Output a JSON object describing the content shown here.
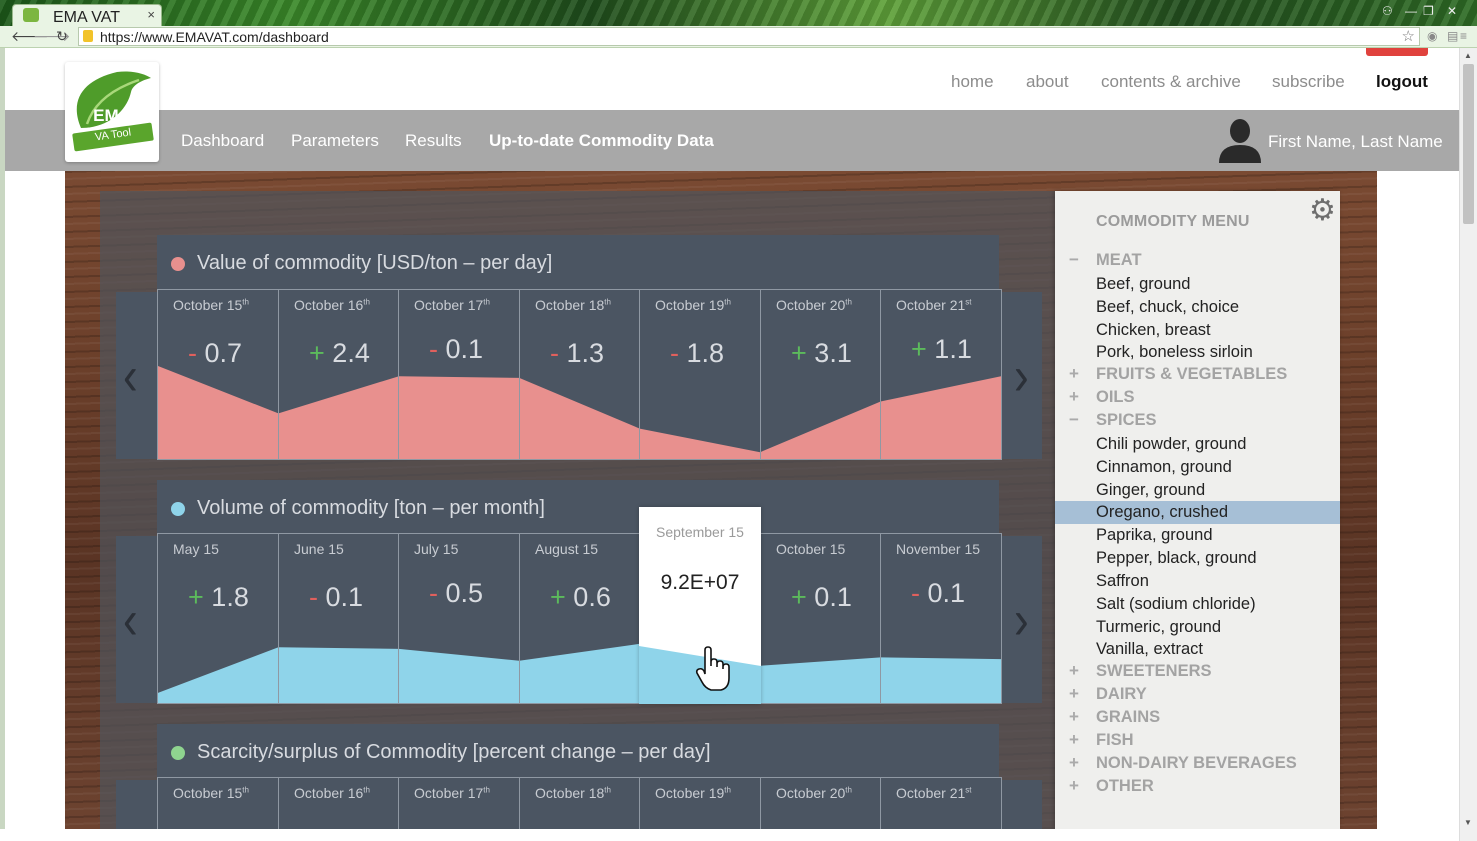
{
  "browser": {
    "tab_title": "EMA VAT",
    "tab_close": "×",
    "url": "https://www.EMAVAT.com/dashboard"
  },
  "header": {
    "nav": [
      "home",
      "about",
      "contents & archive",
      "subscribe",
      "logout"
    ],
    "menu": [
      "Dashboard",
      "Parameters",
      "Results",
      "Up-to-date Commodity Data"
    ],
    "active_menu": "Up-to-date Commodity Data",
    "user_name": "First Name, Last Name"
  },
  "logo": {
    "title": "EMA",
    "subtitle": "VA Tool"
  },
  "colors": {
    "value_series": "#e8908e",
    "volume_series": "#8fd4ea",
    "scarcity_dot": "#8fd48f",
    "selected_row": "#a6bfd6",
    "negative": "#e0605d",
    "positive": "#5cbb5c"
  },
  "panels": [
    {
      "title": "Value of commodity [USD/ton – per day]",
      "dot_color": "#e8908e",
      "labels": [
        {
          "text": "October 15",
          "sup": "th"
        },
        {
          "text": "October 16",
          "sup": "th"
        },
        {
          "text": "October 17",
          "sup": "th"
        },
        {
          "text": "October 18",
          "sup": "th"
        },
        {
          "text": "October 19",
          "sup": "th"
        },
        {
          "text": "October 20",
          "sup": "th"
        },
        {
          "text": "October 21",
          "sup": "st"
        }
      ],
      "values": [
        {
          "sign": "-",
          "num": "0.7"
        },
        {
          "sign": "+",
          "num": "2.4"
        },
        {
          "sign": "-",
          "num": "0.1"
        },
        {
          "sign": "-",
          "num": "1.3"
        },
        {
          "sign": "-",
          "num": "1.8"
        },
        {
          "sign": "+",
          "num": "3.1"
        },
        {
          "sign": "+",
          "num": "1.1"
        }
      ]
    },
    {
      "title": "Volume of commodity [ton – per month]",
      "dot_color": "#8fd4ea",
      "labels": [
        {
          "text": "May 15",
          "sup": ""
        },
        {
          "text": "June 15",
          "sup": ""
        },
        {
          "text": "July 15",
          "sup": ""
        },
        {
          "text": "August 15",
          "sup": ""
        },
        {
          "text": "September 15",
          "sup": ""
        },
        {
          "text": "October 15",
          "sup": ""
        },
        {
          "text": "November 15",
          "sup": ""
        }
      ],
      "values": [
        {
          "sign": "+",
          "num": "1.8"
        },
        {
          "sign": "-",
          "num": "0.1"
        },
        {
          "sign": "-",
          "num": "0.5"
        },
        {
          "sign": "+",
          "num": "0.6"
        },
        {
          "sign": "",
          "num": ""
        },
        {
          "sign": "+",
          "num": "0.1"
        },
        {
          "sign": "-",
          "num": "0.1"
        }
      ],
      "tooltip": {
        "date": "September 15",
        "value": "9.2E+07"
      }
    },
    {
      "title": "Scarcity/surplus of Commodity [percent change – per day]",
      "dot_color": "#8fd48f",
      "labels": [
        {
          "text": "October 15",
          "sup": "th"
        },
        {
          "text": "October 16",
          "sup": "th"
        },
        {
          "text": "October 17",
          "sup": "th"
        },
        {
          "text": "October 18",
          "sup": "th"
        },
        {
          "text": "October 19",
          "sup": "th"
        },
        {
          "text": "October 20",
          "sup": "th"
        },
        {
          "text": "October 21",
          "sup": "st"
        }
      ]
    }
  ],
  "commodity_menu": {
    "title": "COMMODITY MENU",
    "categories": [
      {
        "name": "MEAT",
        "expanded": true,
        "items": [
          "Beef, ground",
          "Beef, chuck, choice",
          "Chicken, breast",
          "Pork, boneless sirloin"
        ]
      },
      {
        "name": "FRUITS & VEGETABLES",
        "expanded": false,
        "items": []
      },
      {
        "name": "OILS",
        "expanded": false,
        "items": []
      },
      {
        "name": "SPICES",
        "expanded": true,
        "items": [
          "Chili powder, ground",
          "Cinnamon, ground",
          "Ginger, ground",
          "Oregano, crushed",
          "Paprika, ground",
          "Pepper, black, ground",
          "Saffron",
          "Salt (sodium chloride)",
          "Turmeric, ground",
          "Vanilla, extract"
        ]
      },
      {
        "name": "SWEETENERS",
        "expanded": false,
        "items": []
      },
      {
        "name": "DAIRY",
        "expanded": false,
        "items": []
      },
      {
        "name": "GRAINS",
        "expanded": false,
        "items": []
      },
      {
        "name": "FISH",
        "expanded": false,
        "items": []
      },
      {
        "name": "NON-DAIRY BEVERAGES",
        "expanded": false,
        "items": []
      },
      {
        "name": "OTHER",
        "expanded": false,
        "items": []
      }
    ],
    "selected_item": "Oregano, crushed"
  },
  "chart_data": [
    {
      "type": "area",
      "title": "Value of commodity [USD/ton – per day]",
      "categories": [
        "October 15th",
        "October 16th",
        "October 17th",
        "October 18th",
        "October 19th",
        "October 20th",
        "October 21st"
      ],
      "values": [
        -0.7,
        2.4,
        -0.1,
        -1.3,
        -1.8,
        3.1,
        1.1
      ],
      "area_levels": [
        0.55,
        0.27,
        0.49,
        0.48,
        0.18,
        0.04,
        0.34,
        0.49
      ]
    },
    {
      "type": "area",
      "title": "Volume of commodity [ton – per month]",
      "categories": [
        "May 15",
        "June 15",
        "July 15",
        "August 15",
        "September 15",
        "October 15",
        "November 15"
      ],
      "values": [
        1.8,
        -0.1,
        -0.5,
        0.6,
        92000000,
        0.1,
        -0.1
      ],
      "area_levels": [
        0.06,
        0.33,
        0.32,
        0.25,
        0.35,
        0.22,
        0.27,
        0.26
      ]
    }
  ]
}
